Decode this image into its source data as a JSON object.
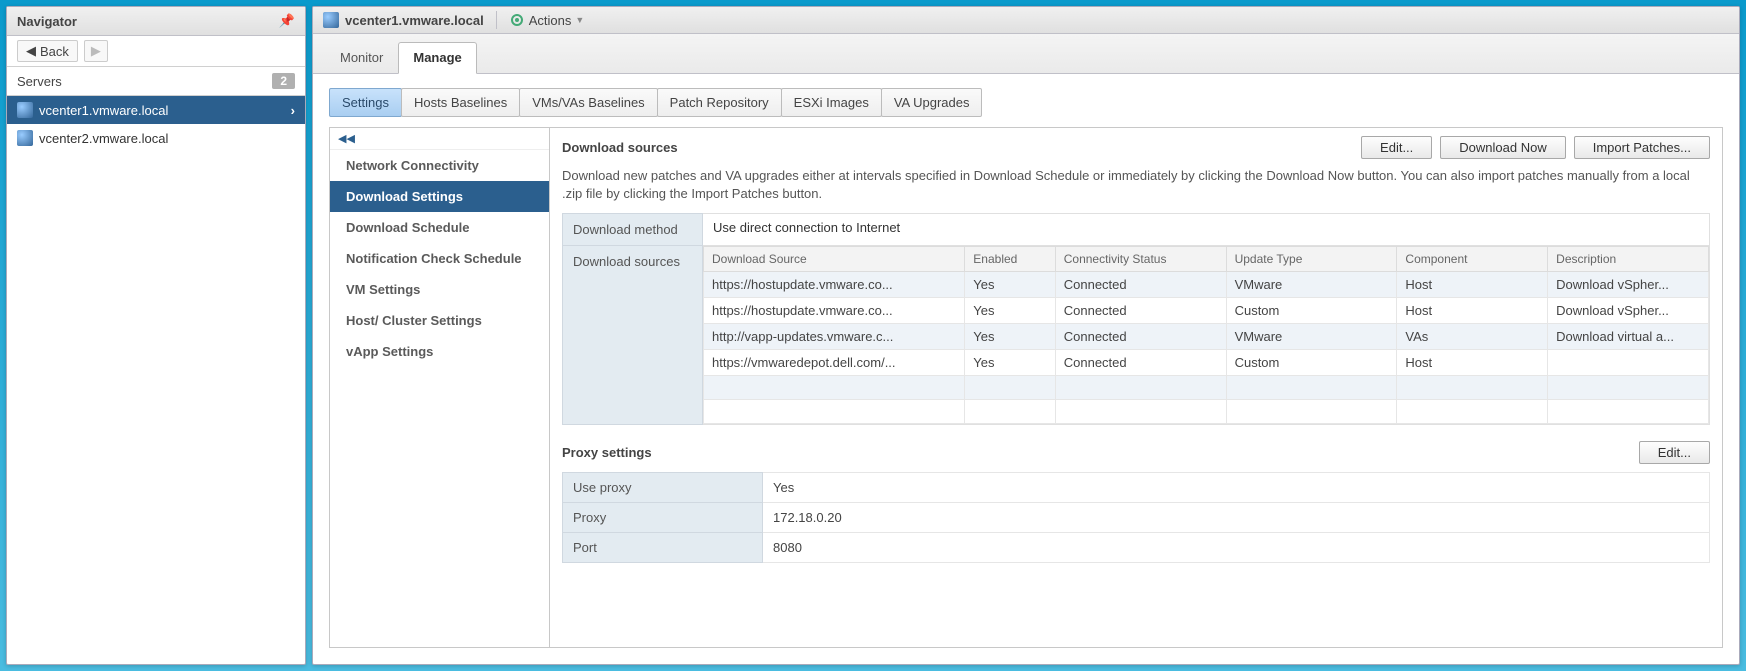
{
  "navigator": {
    "title": "Navigator",
    "back": "Back",
    "servers_label": "Servers",
    "servers_count": "2",
    "items": [
      {
        "label": "vcenter1.vmware.local"
      },
      {
        "label": "vcenter2.vmware.local"
      }
    ]
  },
  "header": {
    "title": "vcenter1.vmware.local",
    "actions": "Actions"
  },
  "topTabs": {
    "monitor": "Monitor",
    "manage": "Manage"
  },
  "subTabs": {
    "settings": "Settings",
    "hostsBaselines": "Hosts Baselines",
    "vmsVasBaselines": "VMs/VAs Baselines",
    "patchRepo": "Patch Repository",
    "esxiImages": "ESXi Images",
    "vaUpgrades": "VA Upgrades"
  },
  "sidebar": [
    "Network Connectivity",
    "Download Settings",
    "Download Schedule",
    "Notification Check Schedule",
    "VM Settings",
    "Host/ Cluster Settings",
    "vApp Settings"
  ],
  "downloadSources": {
    "title": "Download sources",
    "editBtn": "Edit...",
    "downloadNowBtn": "Download Now",
    "importBtn": "Import Patches...",
    "description": "Download new patches and VA upgrades either at intervals specified in Download Schedule or immediately by clicking the Download Now button. You can also import patches manually from a local .zip file by clicking the Import Patches button.",
    "methodLabel": "Download method",
    "methodValue": "Use direct connection to Internet",
    "sourcesLabel": "Download sources",
    "columns": {
      "source": "Download Source",
      "enabled": "Enabled",
      "connectivity": "Connectivity Status",
      "updateType": "Update Type",
      "component": "Component",
      "description": "Description"
    },
    "rows": [
      {
        "source": "https://hostupdate.vmware.co...",
        "enabled": "Yes",
        "connectivity": "Connected",
        "updateType": "VMware",
        "component": "Host",
        "description": "Download vSpher..."
      },
      {
        "source": "https://hostupdate.vmware.co...",
        "enabled": "Yes",
        "connectivity": "Connected",
        "updateType": "Custom",
        "component": "Host",
        "description": "Download vSpher..."
      },
      {
        "source": "http://vapp-updates.vmware.c...",
        "enabled": "Yes",
        "connectivity": "Connected",
        "updateType": "VMware",
        "component": "VAs",
        "description": "Download virtual a..."
      },
      {
        "source": "https://vmwaredepot.dell.com/...",
        "enabled": "Yes",
        "connectivity": "Connected",
        "updateType": "Custom",
        "component": "Host",
        "description": ""
      }
    ]
  },
  "proxy": {
    "title": "Proxy settings",
    "editBtn": "Edit...",
    "useProxyLabel": "Use proxy",
    "useProxyValue": "Yes",
    "proxyLabel": "Proxy",
    "proxyValue": "172.18.0.20",
    "portLabel": "Port",
    "portValue": "8080"
  }
}
